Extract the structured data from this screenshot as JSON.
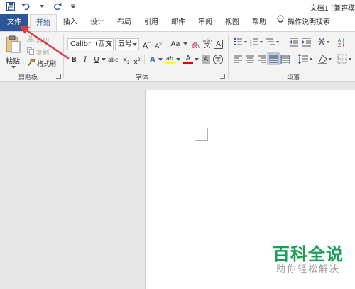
{
  "title_bar": {
    "document_title": "文档1 [兼容模"
  },
  "tabs": [
    {
      "label": "文件"
    },
    {
      "label": "开始"
    },
    {
      "label": "插入"
    },
    {
      "label": "设计"
    },
    {
      "label": "布局"
    },
    {
      "label": "引用"
    },
    {
      "label": "邮件"
    },
    {
      "label": "审阅"
    },
    {
      "label": "视图"
    },
    {
      "label": "帮助"
    },
    {
      "label": "操作说明搜索"
    }
  ],
  "clipboard": {
    "paste_label": "粘贴",
    "cut_label": "剪切",
    "copy_label": "复制",
    "format_painter_label": "格式刷",
    "group_label": "剪贴板"
  },
  "font": {
    "font_name": "Calibri (西文)",
    "font_size": "五号",
    "grow_label": "A",
    "shrink_label": "A",
    "change_case_label": "Aa",
    "bold": "B",
    "italic": "I",
    "underline": "U",
    "strike": "abc",
    "subscript": "x",
    "superscript": "x",
    "subscript_mark": "2",
    "superscript_mark": "2",
    "text_effects": "A",
    "highlight_label": "ab",
    "font_color_label": "A",
    "shading_label": "A",
    "border_label": "A",
    "enclose_label": "字",
    "phonetic_top": "wén",
    "phonetic_bottom": "文",
    "group_label": "字体"
  },
  "paragraph": {
    "group_label": "段落"
  },
  "watermark": {
    "main": "百科全说",
    "sub": "助你轻松解决"
  },
  "colors": {
    "file_tab": "#2b579a",
    "highlight": "#ffff00",
    "font_color": "#e00000",
    "arrow": "#e23a3a",
    "watermark": "#18a05a"
  }
}
